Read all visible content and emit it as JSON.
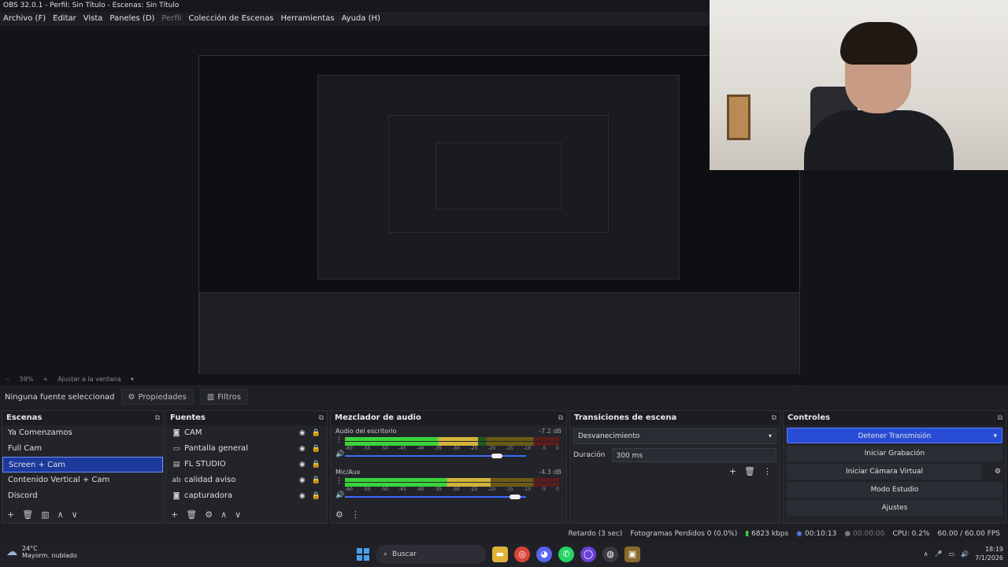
{
  "window": {
    "title": "OBS 32.0.1 - Perfil: Sin Título - Escenas: Sin Título"
  },
  "menu": {
    "items": [
      "Archivo (F)",
      "Editar",
      "Vista",
      "Paneles (D)",
      "Perfil",
      "Colección de Escenas",
      "Herramientas",
      "Ayuda (H)"
    ]
  },
  "zoom": {
    "level": "59%",
    "plus": "+",
    "fit_label": "Ajustar a la ventana"
  },
  "source_bar": {
    "no_source": "Ninguna fuente seleccionad",
    "properties": "Propiedades",
    "filters": "Filtros"
  },
  "scenes": {
    "title": "Escenas",
    "items": [
      "Ya Comenzamos",
      "Full Cam",
      "Screen + Cam",
      "Contenido Vertical + Cam",
      "Discord"
    ],
    "selected": "Screen + Cam"
  },
  "sources": {
    "title": "Fuentes",
    "items": [
      {
        "name": "CAM",
        "icon": "camera-icon"
      },
      {
        "name": "Pantalla general",
        "icon": "monitor-icon"
      },
      {
        "name": "FL STUDIO",
        "icon": "window-icon"
      },
      {
        "name": "calidad aviso",
        "icon": "text-icon"
      },
      {
        "name": "capturadora",
        "icon": "camera-icon"
      }
    ]
  },
  "mixer": {
    "title": "Mezclador de audio",
    "channels": [
      {
        "name": "Audio del escritorio",
        "db": "-7.2 dB",
        "level": 0.62,
        "volume": 0.84
      },
      {
        "name": "Mic/Aux",
        "db": "-4.3 dB",
        "level": 0.68,
        "volume": 0.94
      }
    ],
    "ticks": [
      "-60",
      "-55",
      "-50",
      "-45",
      "-40",
      "-35",
      "-30",
      "-25",
      "-20",
      "-15",
      "-10",
      "-5",
      "0"
    ]
  },
  "transitions": {
    "title": "Transiciones de escena",
    "selected": "Desvanecimiento",
    "duration_label": "Duración",
    "duration": "300 ms"
  },
  "controls": {
    "title": "Controles",
    "stop_stream": "Detener Transmisión",
    "start_recording": "Iniciar Grabación",
    "start_virtual_cam": "Iniciar Cámara Virtual",
    "studio_mode": "Modo Estudio",
    "settings": "Ajustes"
  },
  "status": {
    "delay": "Retardo (3 sec)",
    "dropped": "Fotogramas Perdidos 0 (0.0%)",
    "bitrate": "6823 kbps",
    "stream_time": "00:10:13",
    "record_time": "00:00:00",
    "cpu": "CPU: 0.2%",
    "fps": "60.00 / 60.00 FPS"
  },
  "taskbar": {
    "temp": "24°C",
    "weather": "Mayorm. nublado",
    "search": "Buscar",
    "time": "18:19",
    "date": "7/1/2026"
  }
}
